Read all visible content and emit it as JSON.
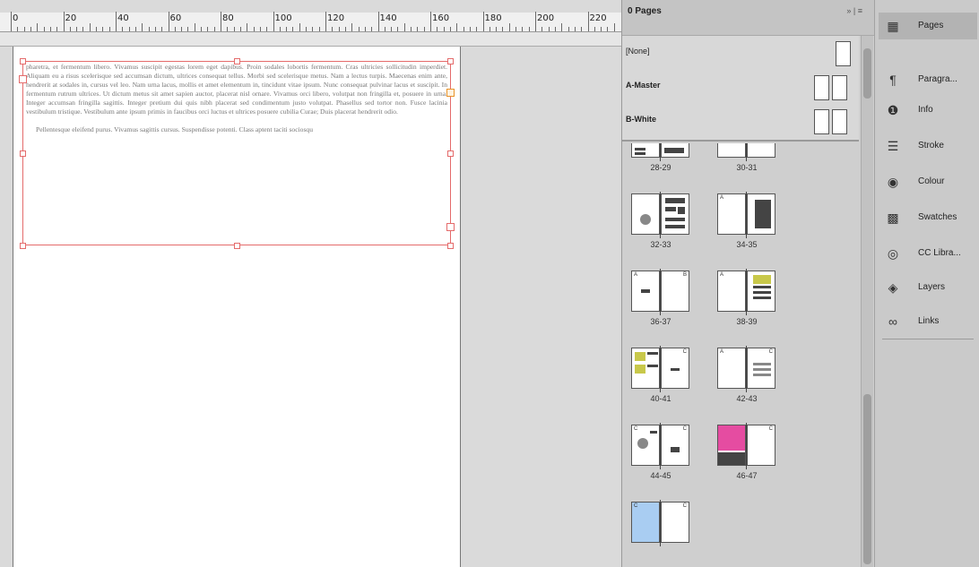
{
  "ruler": {
    "labels": [
      "0",
      "20",
      "40",
      "60",
      "80",
      "100",
      "120",
      "140",
      "160",
      "180",
      "200",
      "220"
    ]
  },
  "document": {
    "paragraph1": "pharetra, et fermentum libero. Vivamus suscipit egestas lorem eget dapibus. Proin sodales lobortis fermentum. Cras ultricies sollicitudin imperdiet. Aliquam eu a risus scelerisque sed accumsan dictum, ultrices consequat tellus. Morbi sed scelerisque metus. Nam a lectus turpis. Maecenas enim ante, hendrerit at sodales in, cursus vel leo. Nam urna lacus, mollis et amet elementum in, tincidunt vitae ipsum. Nunc consequat pulvinar lacus et suscipit. In fermentum rutrum ultrices. Ut dictum metus sit amet sapien auctor, placerat nisl ornare. Vivamus orci libero, volutpat non fringilla et, posuere in urna. Integer accumsan fringilla sagittis. Integer pretium dui quis nibh placerat sed condimentum justo volutpat. Phasellus sed tortor non. Fusce lacinia vestibulum tristique. Vestibulum ante ipsum primis in faucibus orci luctus et ultrices posuere cubilia Curae; Duis placerat hendrerit odio.",
    "paragraph2": "Pellentesque eleifend purus. Vivamus sagittis cursus. Suspendisse potenti. Class aptent taciti sociosqu"
  },
  "pages_panel": {
    "title": "0 Pages",
    "menu": "» | ≡",
    "masters": [
      {
        "label": "[None]",
        "pages": 1
      },
      {
        "label": "A-Master",
        "pages": 2
      },
      {
        "label": "B-White",
        "pages": 2
      }
    ],
    "spreads": [
      "28-29",
      "30-31",
      "32-33",
      "34-35",
      "36-37",
      "38-39",
      "40-41",
      "42-43",
      "44-45",
      "46-47"
    ]
  },
  "dock": {
    "items": [
      {
        "label": "Pages",
        "icon": "pages-icon"
      },
      {
        "label": "Paragra...",
        "icon": "paragraph-icon"
      },
      {
        "label": "Info",
        "icon": "info-icon"
      },
      {
        "label": "Stroke",
        "icon": "stroke-icon"
      },
      {
        "label": "Colour",
        "icon": "colour-icon"
      },
      {
        "label": "Swatches",
        "icon": "swatches-icon"
      },
      {
        "label": "CC Libra...",
        "icon": "cc-libraries-icon"
      },
      {
        "label": "Layers",
        "icon": "layers-icon"
      },
      {
        "label": "Links",
        "icon": "links-icon"
      }
    ]
  }
}
